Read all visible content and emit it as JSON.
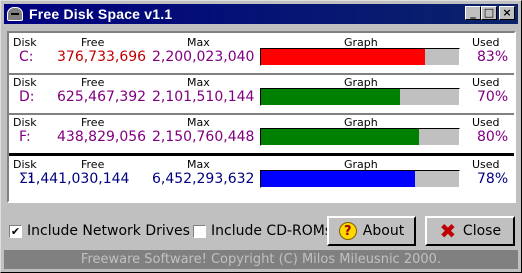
{
  "window": {
    "title": "Free Disk Space v1.1",
    "controls": {
      "minimize": "_",
      "maximize": "□",
      "close": "×"
    }
  },
  "headers": {
    "disk": "Disk",
    "free": "Free",
    "max": "Max",
    "graph": "Graph",
    "used": "Used"
  },
  "drives": [
    {
      "disk": "C:",
      "free": "376,733,696",
      "max": "2,200,023,040",
      "used": "83%",
      "used_fraction": 0.83,
      "bar_color": "#ff0000"
    },
    {
      "disk": "D:",
      "free": "625,467,392",
      "max": "2,101,510,144",
      "used": "70%",
      "used_fraction": 0.7,
      "bar_color": "#008000"
    },
    {
      "disk": "F:",
      "free": "438,829,056",
      "max": "2,150,760,448",
      "used": "80%",
      "used_fraction": 0.8,
      "bar_color": "#008000"
    },
    {
      "disk": "Σ:",
      "free": "1,441,030,144",
      "max": "6,452,293,632",
      "used": "78%",
      "used_fraction": 0.78,
      "bar_color": "#0000ff"
    }
  ],
  "colors": {
    "disk_text": "#800080",
    "free_text_first": "#c00000",
    "free_text": "#800080",
    "total_free_text": "#000080"
  },
  "options": {
    "network_drives": {
      "label": "Include Network Drives",
      "checked": true
    },
    "cdroms": {
      "label": "Include CD-ROMs",
      "checked": false
    }
  },
  "buttons": {
    "about": "About",
    "close": "Close"
  },
  "status": "Freeware Software!   Copyright (C) Milos Mileusnic 2000."
}
